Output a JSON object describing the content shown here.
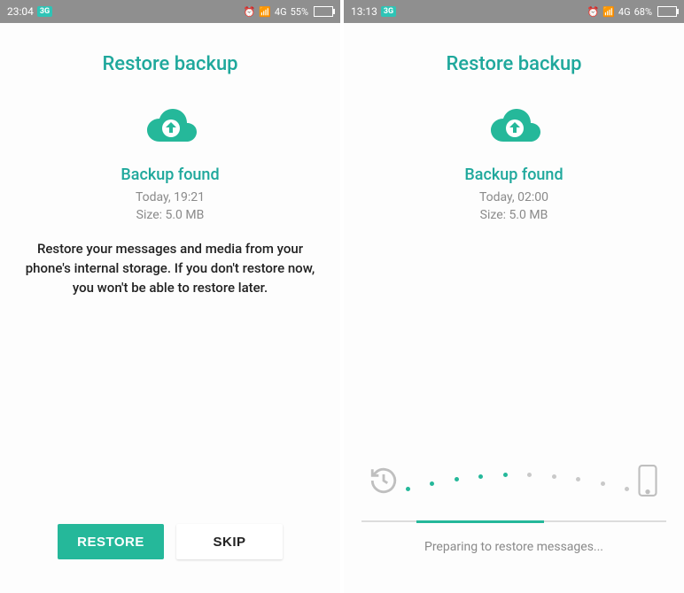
{
  "left": {
    "status": {
      "time": "23:04",
      "badge": "3G",
      "signal": "4G",
      "battery_pct": "55%",
      "battery_fill": 55
    },
    "title": "Restore backup",
    "subtitle": "Backup found",
    "meta_date": "Today, 19:21",
    "meta_size": "Size: 5.0 MB",
    "body": "Restore your messages and media from your phone's internal storage. If you don't restore now, you won't be able to restore later.",
    "restore_label": "RESTORE",
    "skip_label": "SKIP"
  },
  "right": {
    "status": {
      "time": "13:13",
      "badge": "3G",
      "signal": "4G",
      "battery_pct": "68%",
      "battery_fill": 68
    },
    "title": "Restore backup",
    "subtitle": "Backup found",
    "meta_date": "Today, 02:00",
    "meta_size": "Size: 5.0 MB",
    "progress_label": "Preparing to restore messages..."
  },
  "colors": {
    "accent": "#1fa89c",
    "button": "#25b89a"
  }
}
